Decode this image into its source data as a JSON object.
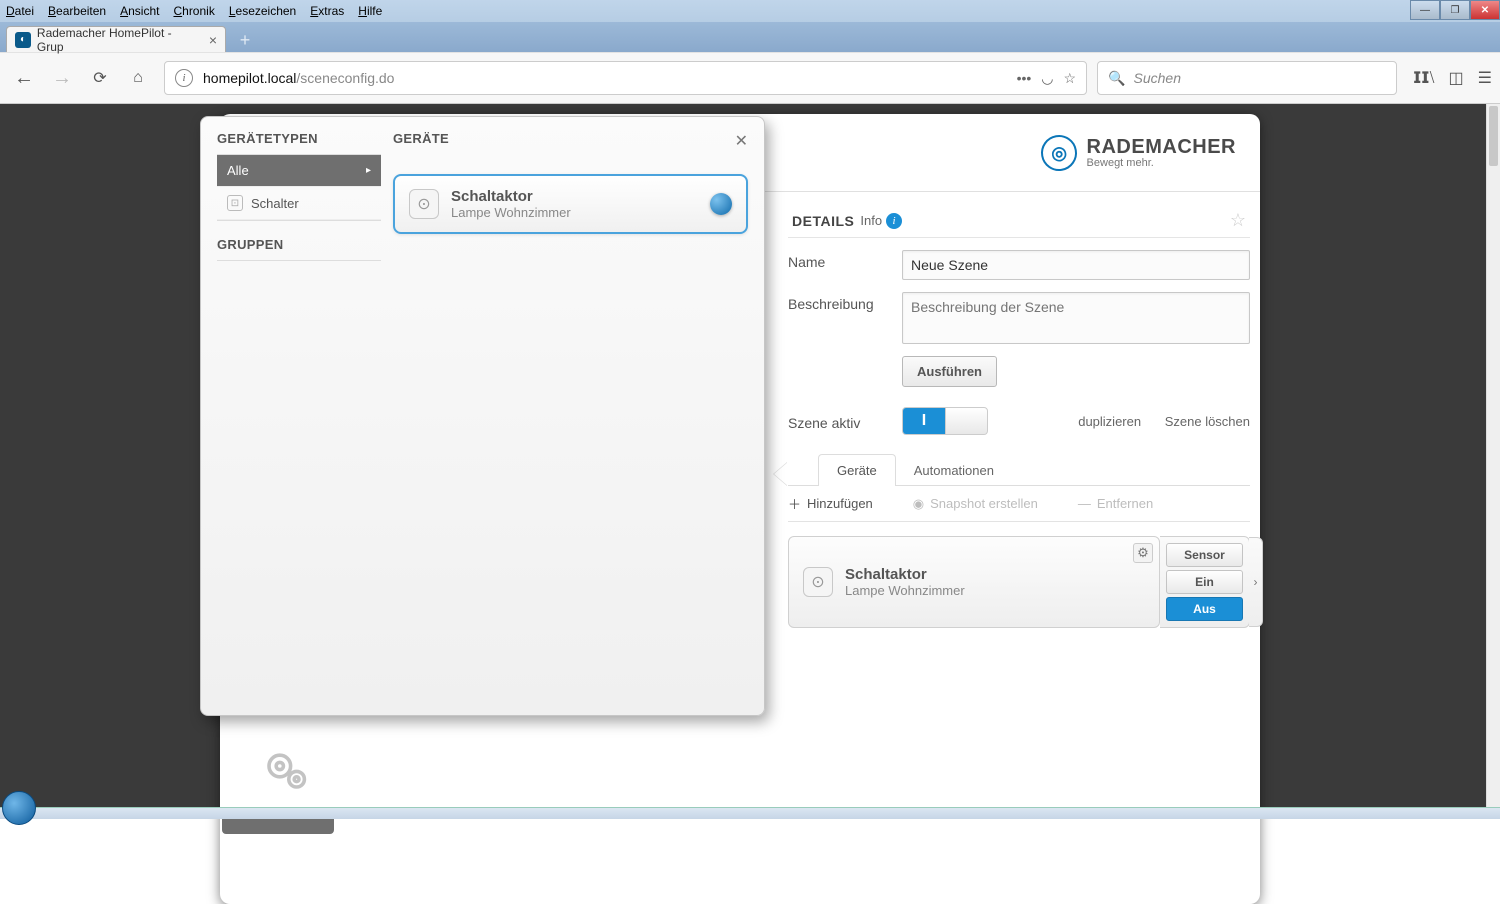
{
  "browser": {
    "menu": [
      "Datei",
      "Bearbeiten",
      "Ansicht",
      "Chronik",
      "Lesezeichen",
      "Extras",
      "Hilfe"
    ],
    "tab_title": "Rademacher HomePilot - Grup",
    "url_host": "homepilot.local",
    "url_path": "/sceneconfig.do",
    "search_placeholder": "Suchen"
  },
  "brand": {
    "name": "RADEMACHER",
    "tagline": "Bewegt mehr."
  },
  "popup": {
    "geraetetypen": "GERÄTETYPEN",
    "geraete": "GERÄTE",
    "gruppen": "GRUPPEN",
    "cat_all": "Alle",
    "cat_schalter": "Schalter",
    "device_name": "Schaltaktor",
    "device_loc": "Lampe Wohnzimmer"
  },
  "details": {
    "header": "DETAILS",
    "info": "Info",
    "label_name": "Name",
    "value_name": "Neue Szene",
    "label_desc": "Beschreibung",
    "placeholder_desc": "Beschreibung der Szene",
    "btn_execute": "Ausführen",
    "label_active": "Szene aktiv",
    "link_dup": "duplizieren",
    "link_del": "Szene löschen",
    "tab_devices": "Geräte",
    "tab_auto": "Automationen",
    "act_add": "Hinzufügen",
    "act_snap": "Snapshot erstellen",
    "act_remove": "Entfernen",
    "dev_name": "Schaltaktor",
    "dev_loc": "Lampe Wohnzimmer",
    "opt_sensor": "Sensor",
    "opt_on": "Ein",
    "opt_off": "Aus"
  }
}
